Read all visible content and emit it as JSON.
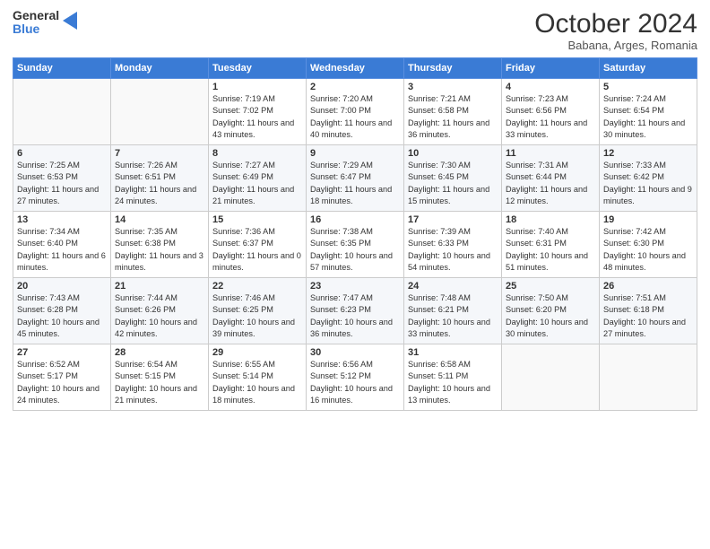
{
  "header": {
    "logo_general": "General",
    "logo_blue": "Blue",
    "month": "October 2024",
    "location": "Babana, Arges, Romania"
  },
  "days_of_week": [
    "Sunday",
    "Monday",
    "Tuesday",
    "Wednesday",
    "Thursday",
    "Friday",
    "Saturday"
  ],
  "weeks": [
    [
      {
        "day": "",
        "info": ""
      },
      {
        "day": "",
        "info": ""
      },
      {
        "day": "1",
        "info": "Sunrise: 7:19 AM\nSunset: 7:02 PM\nDaylight: 11 hours and 43 minutes."
      },
      {
        "day": "2",
        "info": "Sunrise: 7:20 AM\nSunset: 7:00 PM\nDaylight: 11 hours and 40 minutes."
      },
      {
        "day": "3",
        "info": "Sunrise: 7:21 AM\nSunset: 6:58 PM\nDaylight: 11 hours and 36 minutes."
      },
      {
        "day": "4",
        "info": "Sunrise: 7:23 AM\nSunset: 6:56 PM\nDaylight: 11 hours and 33 minutes."
      },
      {
        "day": "5",
        "info": "Sunrise: 7:24 AM\nSunset: 6:54 PM\nDaylight: 11 hours and 30 minutes."
      }
    ],
    [
      {
        "day": "6",
        "info": "Sunrise: 7:25 AM\nSunset: 6:53 PM\nDaylight: 11 hours and 27 minutes."
      },
      {
        "day": "7",
        "info": "Sunrise: 7:26 AM\nSunset: 6:51 PM\nDaylight: 11 hours and 24 minutes."
      },
      {
        "day": "8",
        "info": "Sunrise: 7:27 AM\nSunset: 6:49 PM\nDaylight: 11 hours and 21 minutes."
      },
      {
        "day": "9",
        "info": "Sunrise: 7:29 AM\nSunset: 6:47 PM\nDaylight: 11 hours and 18 minutes."
      },
      {
        "day": "10",
        "info": "Sunrise: 7:30 AM\nSunset: 6:45 PM\nDaylight: 11 hours and 15 minutes."
      },
      {
        "day": "11",
        "info": "Sunrise: 7:31 AM\nSunset: 6:44 PM\nDaylight: 11 hours and 12 minutes."
      },
      {
        "day": "12",
        "info": "Sunrise: 7:33 AM\nSunset: 6:42 PM\nDaylight: 11 hours and 9 minutes."
      }
    ],
    [
      {
        "day": "13",
        "info": "Sunrise: 7:34 AM\nSunset: 6:40 PM\nDaylight: 11 hours and 6 minutes."
      },
      {
        "day": "14",
        "info": "Sunrise: 7:35 AM\nSunset: 6:38 PM\nDaylight: 11 hours and 3 minutes."
      },
      {
        "day": "15",
        "info": "Sunrise: 7:36 AM\nSunset: 6:37 PM\nDaylight: 11 hours and 0 minutes."
      },
      {
        "day": "16",
        "info": "Sunrise: 7:38 AM\nSunset: 6:35 PM\nDaylight: 10 hours and 57 minutes."
      },
      {
        "day": "17",
        "info": "Sunrise: 7:39 AM\nSunset: 6:33 PM\nDaylight: 10 hours and 54 minutes."
      },
      {
        "day": "18",
        "info": "Sunrise: 7:40 AM\nSunset: 6:31 PM\nDaylight: 10 hours and 51 minutes."
      },
      {
        "day": "19",
        "info": "Sunrise: 7:42 AM\nSunset: 6:30 PM\nDaylight: 10 hours and 48 minutes."
      }
    ],
    [
      {
        "day": "20",
        "info": "Sunrise: 7:43 AM\nSunset: 6:28 PM\nDaylight: 10 hours and 45 minutes."
      },
      {
        "day": "21",
        "info": "Sunrise: 7:44 AM\nSunset: 6:26 PM\nDaylight: 10 hours and 42 minutes."
      },
      {
        "day": "22",
        "info": "Sunrise: 7:46 AM\nSunset: 6:25 PM\nDaylight: 10 hours and 39 minutes."
      },
      {
        "day": "23",
        "info": "Sunrise: 7:47 AM\nSunset: 6:23 PM\nDaylight: 10 hours and 36 minutes."
      },
      {
        "day": "24",
        "info": "Sunrise: 7:48 AM\nSunset: 6:21 PM\nDaylight: 10 hours and 33 minutes."
      },
      {
        "day": "25",
        "info": "Sunrise: 7:50 AM\nSunset: 6:20 PM\nDaylight: 10 hours and 30 minutes."
      },
      {
        "day": "26",
        "info": "Sunrise: 7:51 AM\nSunset: 6:18 PM\nDaylight: 10 hours and 27 minutes."
      }
    ],
    [
      {
        "day": "27",
        "info": "Sunrise: 6:52 AM\nSunset: 5:17 PM\nDaylight: 10 hours and 24 minutes."
      },
      {
        "day": "28",
        "info": "Sunrise: 6:54 AM\nSunset: 5:15 PM\nDaylight: 10 hours and 21 minutes."
      },
      {
        "day": "29",
        "info": "Sunrise: 6:55 AM\nSunset: 5:14 PM\nDaylight: 10 hours and 18 minutes."
      },
      {
        "day": "30",
        "info": "Sunrise: 6:56 AM\nSunset: 5:12 PM\nDaylight: 10 hours and 16 minutes."
      },
      {
        "day": "31",
        "info": "Sunrise: 6:58 AM\nSunset: 5:11 PM\nDaylight: 10 hours and 13 minutes."
      },
      {
        "day": "",
        "info": ""
      },
      {
        "day": "",
        "info": ""
      }
    ]
  ]
}
